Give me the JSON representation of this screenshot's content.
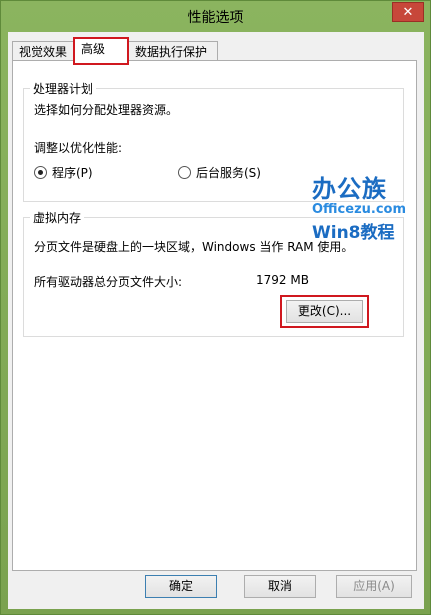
{
  "window": {
    "title": "性能选项",
    "close_glyph": "✕"
  },
  "tabs": [
    {
      "label": "视觉效果"
    },
    {
      "label": "高级"
    },
    {
      "label": "数据执行保护"
    }
  ],
  "processor": {
    "title": "处理器计划",
    "description": "选择如何分配处理器资源。",
    "adjust_label": "调整以优化性能:",
    "options": [
      {
        "label": "程序(P)",
        "selected": true
      },
      {
        "label": "后台服务(S)",
        "selected": false
      }
    ]
  },
  "virtual_memory": {
    "title": "虚拟内存",
    "description": "分页文件是硬盘上的一块区域，Windows 当作 RAM 使用。",
    "total_label": "所有驱动器总分页文件大小:",
    "total_value": "1792 MB",
    "change_button": "更改(C)..."
  },
  "footer": {
    "ok": "确定",
    "cancel": "取消",
    "apply": "应用(A)"
  },
  "watermark": {
    "line1": "办公族",
    "line2": "Officezu.com",
    "line3": "Win8教程"
  },
  "colors": {
    "highlight": "#d0181f",
    "watermark_blue": "#1b6cc2"
  }
}
